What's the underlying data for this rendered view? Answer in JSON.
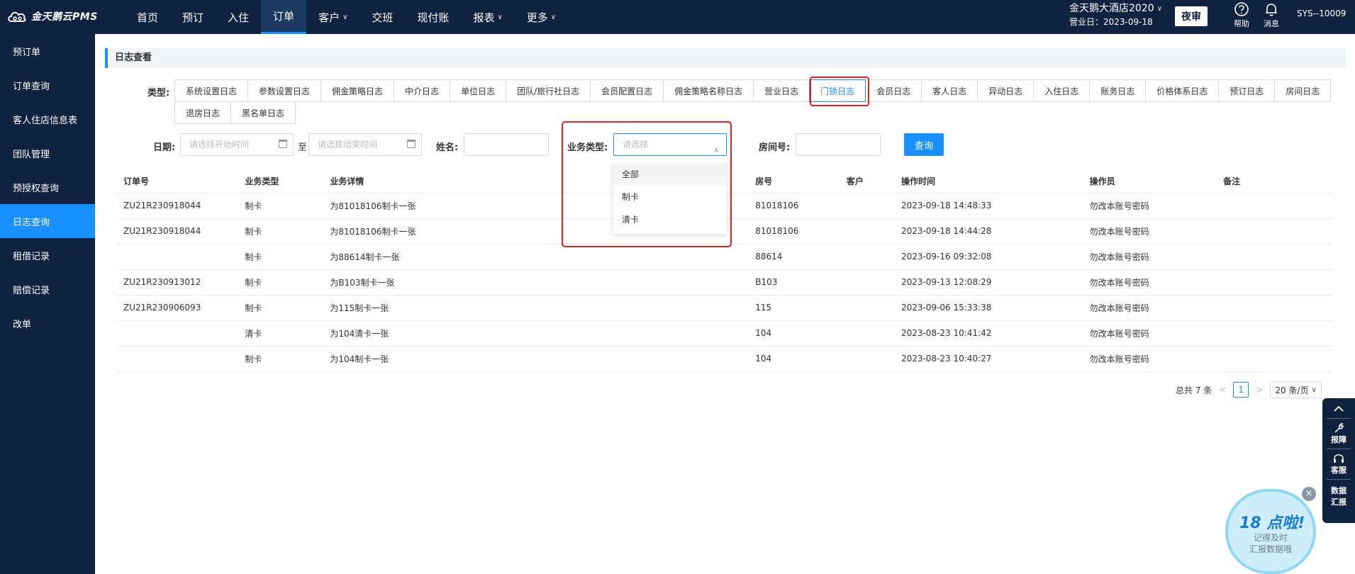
{
  "app": {
    "logo_text": "金天鹅云PMS"
  },
  "nav": [
    {
      "label": "首页",
      "active": false,
      "dropdown": false
    },
    {
      "label": "预订",
      "active": false,
      "dropdown": false
    },
    {
      "label": "入住",
      "active": false,
      "dropdown": false
    },
    {
      "label": "订单",
      "active": true,
      "dropdown": false
    },
    {
      "label": "客户",
      "active": false,
      "dropdown": true
    },
    {
      "label": "交班",
      "active": false,
      "dropdown": false
    },
    {
      "label": "现付账",
      "active": false,
      "dropdown": false
    },
    {
      "label": "报表",
      "active": false,
      "dropdown": true
    },
    {
      "label": "更多",
      "active": false,
      "dropdown": true
    }
  ],
  "header": {
    "hotel_name": "金天鹅大酒店2020",
    "business_date": "营业日：2023-09-18",
    "night_audit": "夜审",
    "help": "帮助",
    "messages": "消息",
    "user": "SYS--10009"
  },
  "sidebar": [
    {
      "label": "预订单",
      "active": false
    },
    {
      "label": "订单查询",
      "active": false
    },
    {
      "label": "客人住店信息表",
      "active": false
    },
    {
      "label": "团队管理",
      "active": false
    },
    {
      "label": "预授权查询",
      "active": false
    },
    {
      "label": "日志查询",
      "active": true
    },
    {
      "label": "租借记录",
      "active": false
    },
    {
      "label": "赔偿记录",
      "active": false
    },
    {
      "label": "改单",
      "active": false
    }
  ],
  "page": {
    "title": "日志查看"
  },
  "type_filter": {
    "label": "类型:",
    "options": [
      "系统设置日志",
      "参数设置日志",
      "佣金策略日志",
      "中介日志",
      "单位日志",
      "团队/旅行社日志",
      "会员配置日志",
      "佣金策略名称日志",
      "营业日志",
      "门锁日志",
      "会员日志",
      "客人日志",
      "异动日志",
      "入住日志",
      "账务日志",
      "价格体系日志",
      "预订日志",
      "房间日志",
      "退房日志",
      "黑名单日志"
    ],
    "active": "门锁日志"
  },
  "filters": {
    "date_label": "日期:",
    "start_placeholder": "请选择开始时间",
    "to": "至",
    "end_placeholder": "请选择结束时间",
    "name_label": "姓名:",
    "name_value": "",
    "biz_type_label": "业务类型:",
    "biz_type_placeholder": "请选择",
    "room_label": "房间号:",
    "room_value": "",
    "query_button": "查询"
  },
  "biz_type_dropdown": [
    "全部",
    "制卡",
    "清卡"
  ],
  "table": {
    "columns": [
      "订单号",
      "业务类型",
      "业务详情",
      "房号",
      "客户",
      "操作时间",
      "操作员",
      "备注"
    ],
    "rows": [
      [
        "ZU21R230918044",
        "制卡",
        "为81018106制卡一张",
        "81018106",
        "",
        "2023-09-18 14:48:33",
        "勿改本账号密码",
        ""
      ],
      [
        "ZU21R230918044",
        "制卡",
        "为81018106制卡一张",
        "81018106",
        "",
        "2023-09-18 14:44:28",
        "勿改本账号密码",
        ""
      ],
      [
        "",
        "制卡",
        "为88614制卡一张",
        "88614",
        "",
        "2023-09-16 09:32:08",
        "勿改本账号密码",
        ""
      ],
      [
        "ZU21R230913012",
        "制卡",
        "为B103制卡一张",
        "B103",
        "",
        "2023-09-13 12:08:29",
        "勿改本账号密码",
        ""
      ],
      [
        "ZU21R230906093",
        "制卡",
        "为115制卡一张",
        "115",
        "",
        "2023-09-06 15:33:38",
        "勿改本账号密码",
        ""
      ],
      [
        "",
        "清卡",
        "为104清卡一张",
        "104",
        "",
        "2023-08-23 10:41:42",
        "勿改本账号密码",
        ""
      ],
      [
        "",
        "制卡",
        "为104制卡一张",
        "104",
        "",
        "2023-08-23 10:40:27",
        "勿改本账号密码",
        ""
      ]
    ]
  },
  "pagination": {
    "total": "总共 7 条",
    "current_page": "1",
    "page_size": "20 条/页"
  },
  "float_panel": {
    "report_issue": "报障",
    "service": "客服",
    "data": "数据",
    "summary": "汇报"
  },
  "promo": {
    "title": "18 点啦!",
    "line1": "记得及时",
    "line2": "汇报数据哦",
    "close": "×"
  },
  "colors": {
    "nav_bg": "#0f2340",
    "accent": "#1890ff",
    "highlight": "#e02020"
  }
}
